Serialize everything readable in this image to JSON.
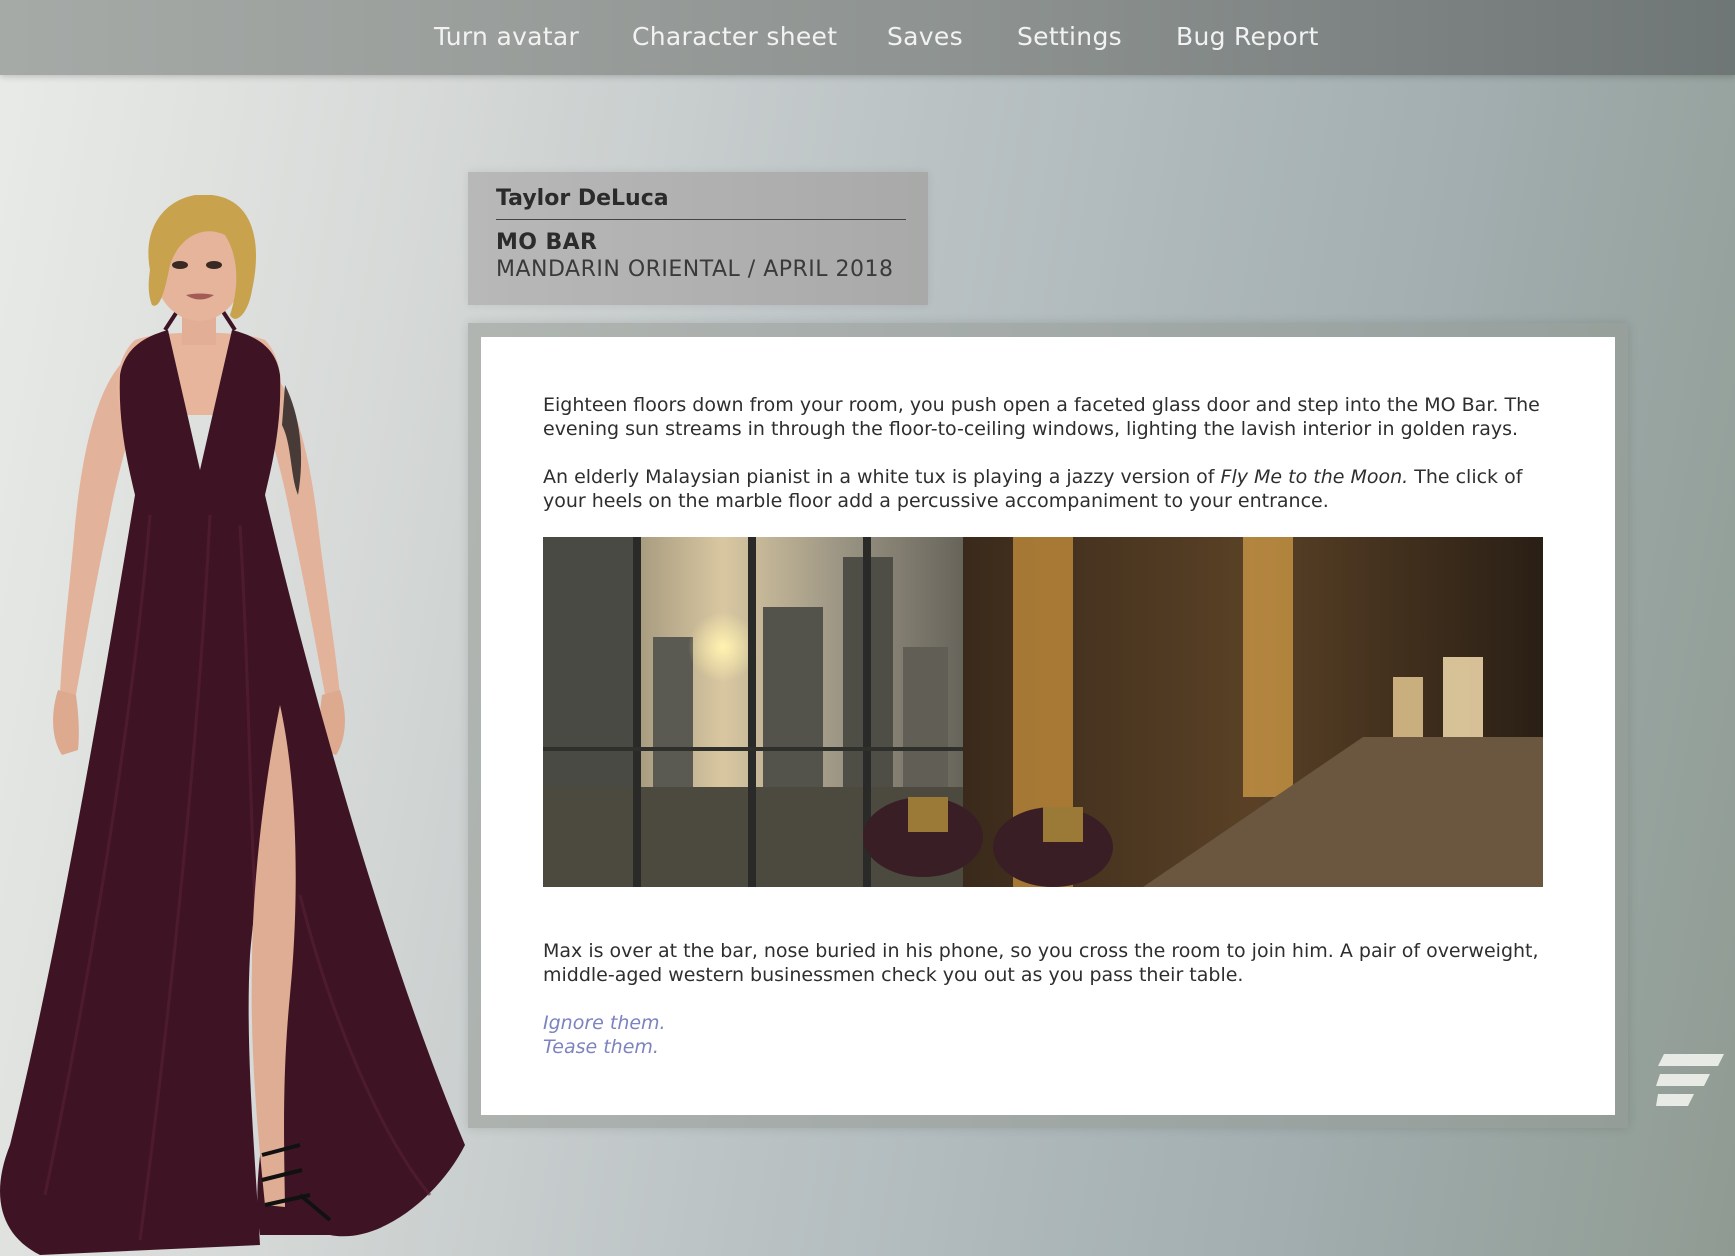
{
  "nav": {
    "items": [
      {
        "label": "Turn avatar"
      },
      {
        "label": "Character sheet"
      },
      {
        "label": "Saves"
      },
      {
        "label": "Settings"
      },
      {
        "label": "Bug Report"
      }
    ]
  },
  "header": {
    "character_name": "Taylor DeLuca",
    "location": "MO BAR",
    "sublocation": "MANDARIN ORIENTAL / APRIL 2018"
  },
  "story": {
    "para1": "Eighteen floors down from your room, you push open a faceted glass door and step into the MO Bar. The evening sun streams in through the floor-to-ceiling windows, lighting the lavish interior in golden rays.",
    "para2_pre": "An elderly Malaysian pianist in a white tux is playing a jazzy version of ",
    "para2_song": "Fly Me to the Moon.",
    "para2_post": " The click of your heels on the marble floor add a percussive accompaniment to your entrance.",
    "para3": "Max is over at the bar, nose buried in his phone, so you cross the room to join him. A pair of overweight, middle-aged western businessmen check you out as you pass their table.",
    "choices": [
      {
        "label": "Ignore them."
      },
      {
        "label": "Tease them."
      }
    ]
  },
  "icons": {
    "menu": "menu-lines-icon"
  },
  "colors": {
    "choice": "#7c83bf",
    "dress": "#3e1424",
    "hair": "#c9a24e"
  }
}
